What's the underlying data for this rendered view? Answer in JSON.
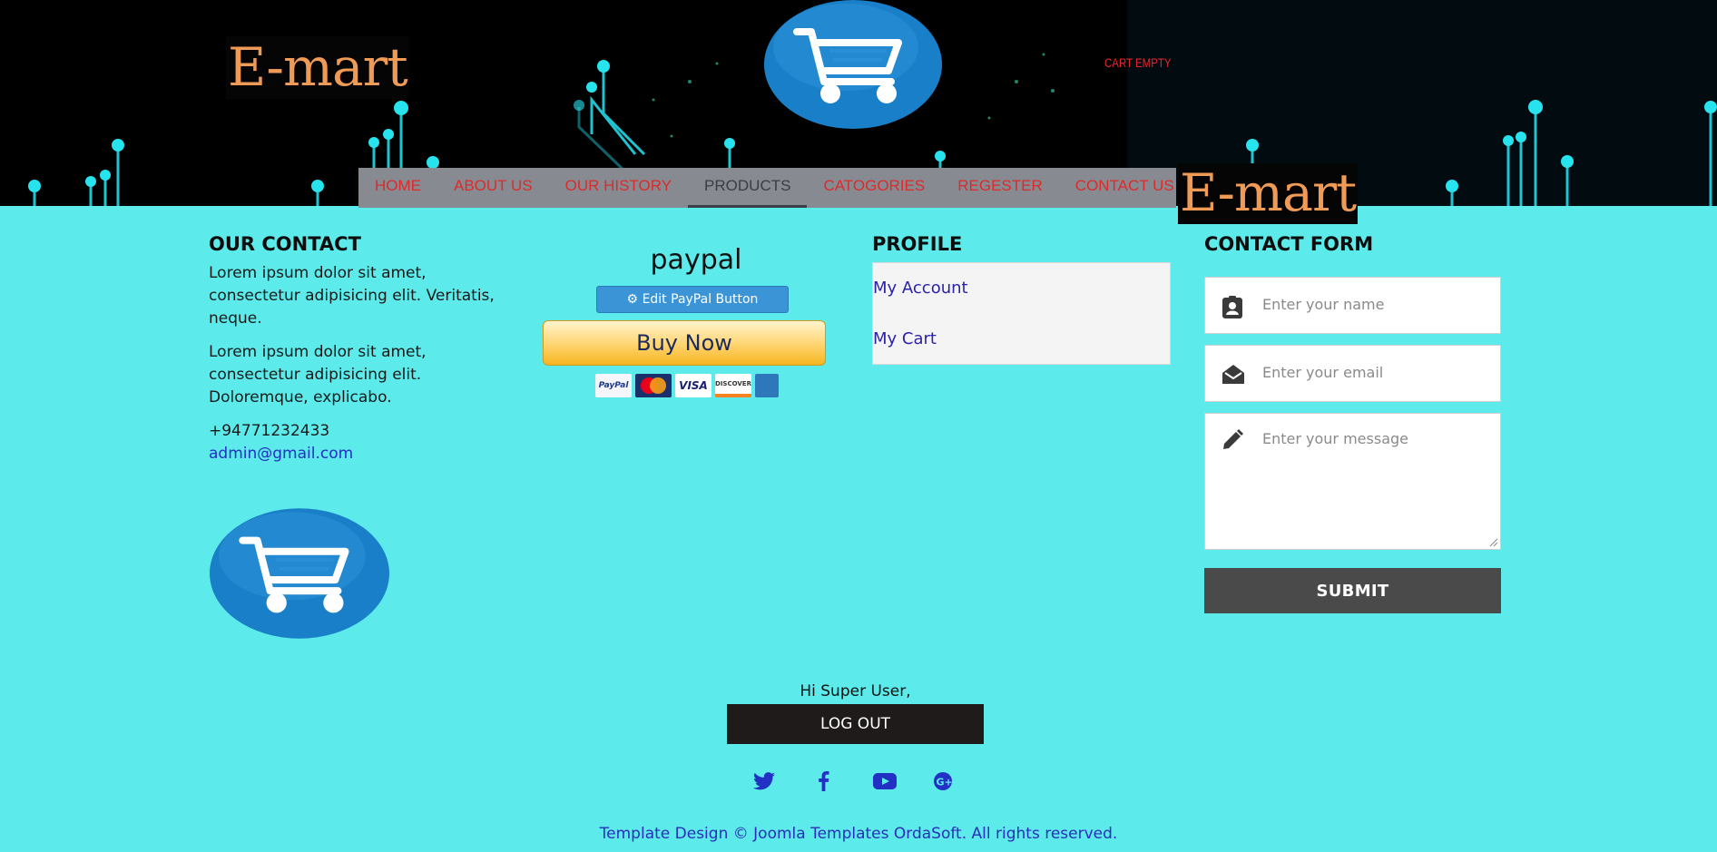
{
  "brand": {
    "name": "E-mart",
    "name_secondary": "E-mart"
  },
  "header": {
    "cart_status": "CART EMPTY"
  },
  "nav": {
    "items": [
      {
        "label": "HOME"
      },
      {
        "label": "ABOUT US"
      },
      {
        "label": "OUR HISTORY"
      },
      {
        "label": "PRODUCTS",
        "active": true
      },
      {
        "label": "CATOGORIES"
      },
      {
        "label": "REGESTER"
      },
      {
        "label": "CONTACT US"
      }
    ]
  },
  "contact": {
    "heading": "OUR CONTACT",
    "paragraph1": "Lorem ipsum dolor sit amet, consectetur adipisicing elit. Veritatis, neque.",
    "paragraph2": "Lorem ipsum dolor sit amet, consectetur adipisicing elit. Doloremque, explicabo.",
    "phone": "+94771232433",
    "email": "admin@gmail.com"
  },
  "paypal": {
    "title": "paypal",
    "edit_button": "Edit PayPal Button",
    "buy_button": "Buy Now",
    "cards": [
      "PayPal",
      "MasterCard",
      "VISA",
      "DISCOVER",
      "AMEX"
    ]
  },
  "profile": {
    "heading": "PROFILE",
    "links": [
      "My Account",
      "My Cart"
    ]
  },
  "contact_form": {
    "heading": "CONTACT FORM",
    "name_placeholder": "Enter your name",
    "email_placeholder": "Enter your email",
    "message_placeholder": "Enter your message",
    "submit_label": "SUBMIT"
  },
  "footer": {
    "greeting": "Hi Super User,",
    "logout_label": "LOG OUT",
    "social_icons": [
      "twitter-icon",
      "facebook-icon",
      "youtube-icon",
      "google-plus-icon"
    ],
    "copyright": "Template Design © Joomla Templates OrdaSoft. All rights reserved."
  },
  "colors": {
    "page_bg": "#5ceaea",
    "nav_bg": "#878a91",
    "nav_text": "#dc2b2b",
    "brand_text": "#ef9a55",
    "link": "#2330c4"
  }
}
